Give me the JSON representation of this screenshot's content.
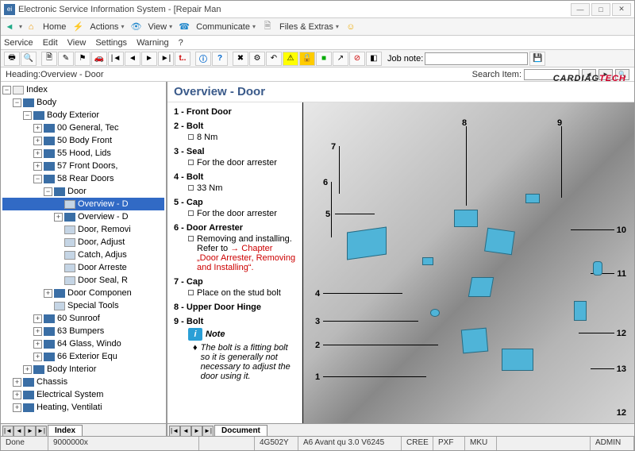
{
  "window": {
    "title": "Electronic Service Information System - [Repair Man"
  },
  "toolbar": {
    "home": "Home",
    "actions": "Actions",
    "view": "View",
    "comm": "Communicate",
    "files": "Files & Extras"
  },
  "menu": {
    "service": "Service",
    "edit": "Edit",
    "view": "View",
    "settings": "Settings",
    "warning": "Warning",
    "help": "?"
  },
  "jobnote": {
    "label": "Job note:"
  },
  "heading": {
    "label": "Heading:",
    "value": "Overview - Door",
    "search": "Search Item:"
  },
  "tree": {
    "index": "Index",
    "body": "Body",
    "ext": "Body Exterior",
    "n00": "00 General, Tec",
    "n50": "50 Body Front",
    "n55": "55 Hood, Lids",
    "n57": "57 Front Doors,",
    "n58": "58 Rear Doors",
    "door": "Door",
    "ov1": "Overview - D",
    "ov2": "Overview - D",
    "rem": "Door, Removi",
    "adj": "Door, Adjust",
    "cat": "Catch, Adjus",
    "arr": "Door Arreste",
    "seal": "Door Seal, R",
    "comp": "Door Componen",
    "tools": "Special Tools",
    "n60": "60 Sunroof",
    "n63": "63 Bumpers",
    "n64": "64 Glass, Windo",
    "n66": "66 Exterior Equ",
    "int": "Body Interior",
    "chas": "Chassis",
    "elec": "Electrical System",
    "heat": "Heating, Ventilati"
  },
  "tabs": {
    "index": "Index",
    "doc": "Document"
  },
  "doc": {
    "title": "Overview - Door",
    "i1": {
      "n": "1 -",
      "t": "Front Door"
    },
    "i2": {
      "n": "2 -",
      "t": "Bolt",
      "s": "8 Nm"
    },
    "i3": {
      "n": "3 -",
      "t": "Seal",
      "s": "For the door arrester"
    },
    "i4": {
      "n": "4 -",
      "t": "Bolt",
      "s": "33 Nm"
    },
    "i5": {
      "n": "5 -",
      "t": "Cap",
      "s": "For the door arrester"
    },
    "i6": {
      "n": "6 -",
      "t": "Door Arrester",
      "s": "Removing and installing. Refer to",
      "ref": "→ Chapter „Door Arrester, Removing and Installing“."
    },
    "i7": {
      "n": "7 -",
      "t": "Cap",
      "s": "Place on the stud bolt"
    },
    "i8": {
      "n": "8 -",
      "t": "Upper Door Hinge"
    },
    "i9": {
      "n": "9 -",
      "t": "Bolt"
    },
    "note": {
      "label": "Note",
      "text": "The bolt is a fitting bolt so it is generally not necessary to adjust the door using it."
    }
  },
  "status": {
    "done": "Done",
    "code": "9000000x",
    "vin": "4G502Y",
    "model": "A6 Avant qu 3.0 V6245",
    "c1": "CREE",
    "c2": "PXF",
    "c3": "MKU",
    "user": "ADMIN"
  },
  "watermark": {
    "p1": "CARDIAG",
    "p2": "TECH"
  }
}
